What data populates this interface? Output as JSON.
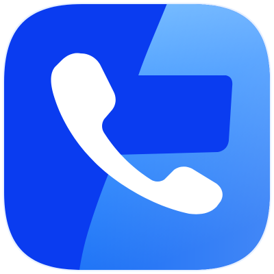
{
  "app_icon": {
    "icon_name": "phone-handset-icon",
    "glyph": "phone handset on split blue rounded-square tile",
    "colors": {
      "primary_blue": "#0a3cf0",
      "light_blue_top": "#5fb0ff",
      "light_blue_mid": "#2f8cff",
      "light_blue_bottom": "#1a6ef5",
      "handset": "#ffffff",
      "background": "#ffffff"
    }
  }
}
